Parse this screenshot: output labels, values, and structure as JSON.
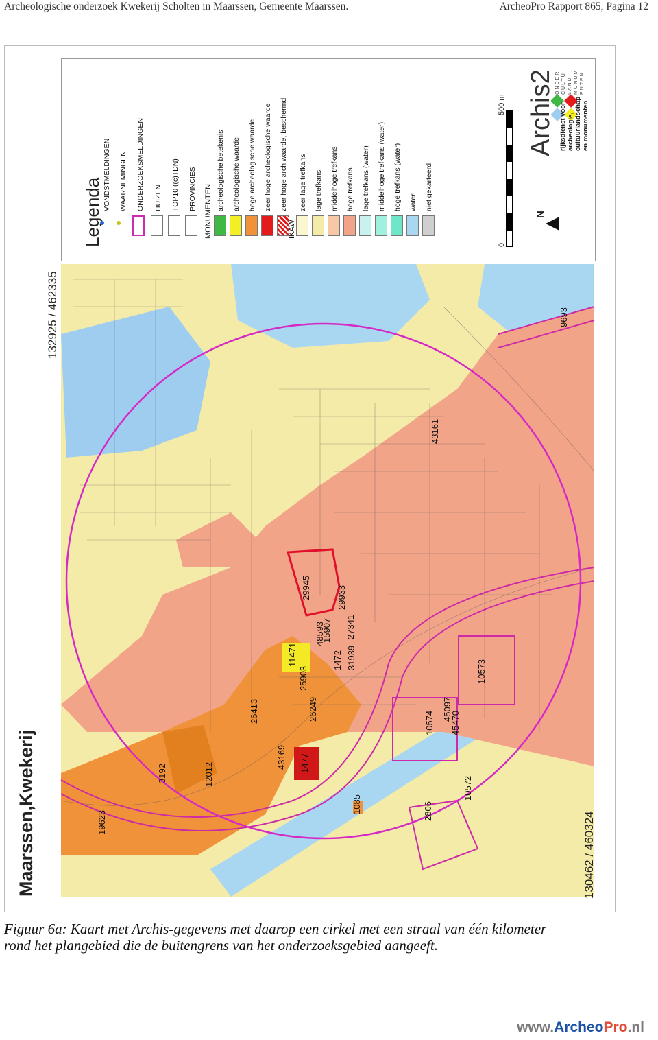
{
  "header": {
    "left": "Archeologische onderzoek  Kwekerij Scholten in Maarssen, Gemeente Maarssen.",
    "right": "ArcheoPro Rapport 865, Pagina 12"
  },
  "map": {
    "title": "Maarssen,Kwekerij",
    "coord_top": "132925 / 462335",
    "coord_bottom": "130462 / 460324",
    "legend": {
      "title": "Legenda",
      "group1": [
        "VONDSTMELDINGEN",
        "WAARNEMINGEN",
        "ONDERZOEKSMELDINGEN",
        "HUIZEN",
        "TOP10 ((c)TDN)",
        "PROVINCIES"
      ],
      "monumenten_title": "MONUMENTEN",
      "monumenten": [
        "archeologische betekenis",
        "archeologische waarde",
        "hoge archeologische waarde",
        "zeer hoge archeologische waarde",
        "zeer hoge arch waarde, beschermd"
      ],
      "ikaw_title": "IKAW",
      "ikaw": [
        "zeer lage trefkans",
        "lage trefkans",
        "middelhoge trefkans",
        "hoge trefkans",
        "lage trefkans (water)",
        "middelhoge trefkans (water)",
        "hoge trefkans (water)",
        "water",
        "niet gekarteerd"
      ],
      "north": "N",
      "scale_start": "0",
      "scale_end": "500 m",
      "archis": "Archis2",
      "rijksdienst": [
        "rijksdienst voor",
        "archeologie,",
        "cultuurlandschap",
        "en monumenten"
      ],
      "org_letters": [
        "ONDER",
        "CULTU",
        "LAND",
        "MONUM",
        "ENTEN"
      ]
    },
    "labels": [
      "29945",
      "10573",
      "10574",
      "45097",
      "45470",
      "10572",
      "2806",
      "1085",
      "1477",
      "43169",
      "12012",
      "3192",
      "19623",
      "26413",
      "26249",
      "25903",
      "11471",
      "31939",
      "27341",
      "1472",
      "29933",
      "9693",
      "43161",
      "15907",
      "48593"
    ]
  },
  "caption": {
    "line1": "Figuur 6a: Kaart met Archis-gegevens met daarop een cirkel met een straal van één kilometer",
    "line2": "rond het plangebied die de buitengrens van het onderzoeksgebied aangeeft."
  },
  "footer": {
    "prefix": "www.",
    "brand": "Archeo",
    "pro": "Pro",
    "suffix": ".nl"
  }
}
